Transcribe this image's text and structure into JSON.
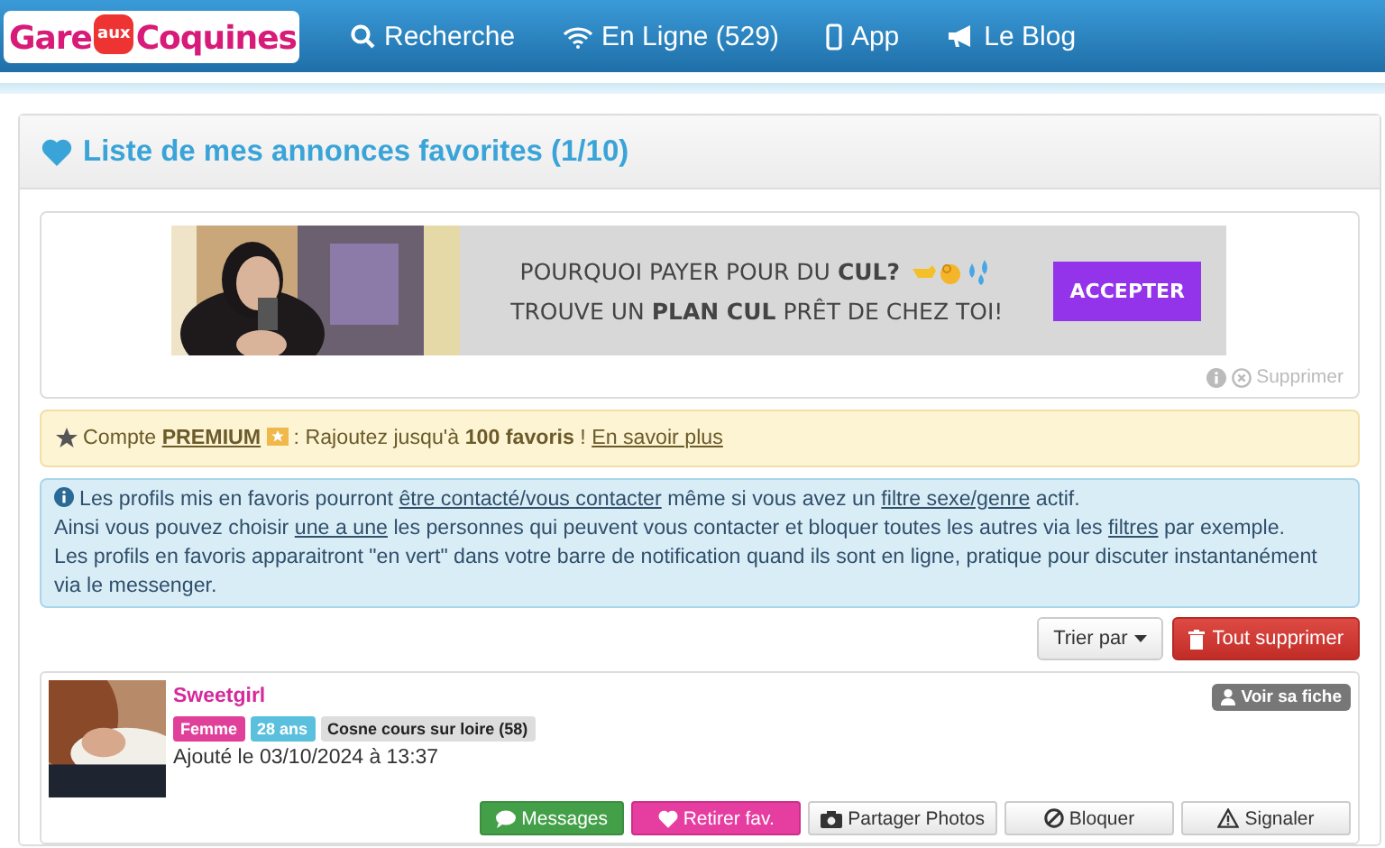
{
  "header": {
    "logo": [
      "Gare",
      "aux",
      "Coquines"
    ],
    "nav": [
      {
        "kind": "search",
        "label": "Recherche"
      },
      {
        "kind": "wifi",
        "label": "En Ligne (529)"
      },
      {
        "kind": "phone",
        "label": "App"
      },
      {
        "kind": "megaphone",
        "label": "Le Blog"
      }
    ]
  },
  "panel": {
    "title": "Liste de mes annonces favorites (1/10)"
  },
  "ad": {
    "line_1": [
      {
        "kind": "text",
        "text": "POURQUOI PAYER POUR DU "
      },
      {
        "kind": "bold",
        "text": "CUL?"
      }
    ],
    "line_2": [
      {
        "kind": "text",
        "text": "TROUVE UN "
      },
      {
        "kind": "bold",
        "text": "PLAN CUL"
      },
      {
        "kind": "text",
        "text": " PRÊT DE CHEZ TOI!"
      }
    ],
    "button": "ACCEPTER",
    "remove": "Supprimer"
  },
  "premium_alert": [
    {
      "kind": "text",
      "text": "Compte "
    },
    {
      "kind": "bold_link",
      "text": "PREMIUM"
    },
    {
      "kind": "badge"
    },
    {
      "kind": "text",
      "text": " : Rajoutez jusqu'à "
    },
    {
      "kind": "bold",
      "text": "100 favoris"
    },
    {
      "kind": "text",
      "text": " ! "
    },
    {
      "kind": "link",
      "text": "En savoir plus"
    }
  ],
  "info_alert": [
    [
      {
        "kind": "text",
        "text": "Les profils mis en favoris pourront "
      },
      {
        "kind": "link",
        "text": "être contacté/vous contacter"
      },
      {
        "kind": "text",
        "text": " même si vous avez un "
      },
      {
        "kind": "link",
        "text": "filtre sexe/genre"
      },
      {
        "kind": "text",
        "text": " actif."
      }
    ],
    [
      {
        "kind": "text",
        "text": "Ainsi vous pouvez choisir "
      },
      {
        "kind": "link",
        "text": "une a une"
      },
      {
        "kind": "text",
        "text": " les personnes qui peuvent vous contacter et bloquer toutes les autres via les "
      },
      {
        "kind": "link",
        "text": "filtres"
      },
      {
        "kind": "text",
        "text": " par exemple."
      }
    ],
    [
      {
        "kind": "text",
        "text": "Les profils en favoris apparaitront \"en vert\" dans votre barre de notification quand ils sont en ligne, pratique pour discuter instantanément via le messenger."
      }
    ]
  ],
  "toolbar": {
    "sort": "Trier par",
    "delete_all": "Tout supprimer"
  },
  "favorites": [
    {
      "name": "Sweetgirl",
      "tags": [
        {
          "text": "Femme",
          "color": "#e0409a"
        },
        {
          "text": "28 ans",
          "color": "#5bc0de"
        },
        {
          "text": "Cosne cours sur loire (58)",
          "color": "#dddddd"
        }
      ],
      "added": "Ajouté le 03/10/2024 à 13:37",
      "view": "Voir sa fiche",
      "actions": [
        {
          "kind": "messages",
          "label": "Messages"
        },
        {
          "kind": "unfav",
          "label": "Retirer fav."
        },
        {
          "kind": "photos",
          "label": "Partager Photos"
        },
        {
          "kind": "block",
          "label": "Bloquer"
        },
        {
          "kind": "report",
          "label": "Signaler"
        }
      ]
    }
  ]
}
